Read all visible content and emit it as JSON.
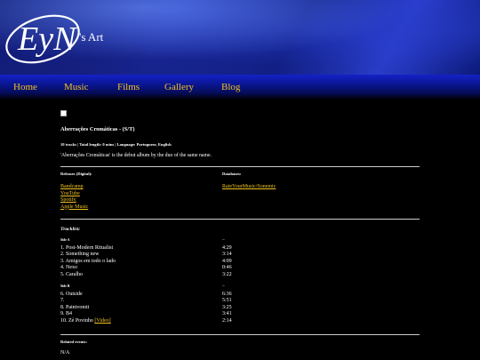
{
  "site": {
    "logo_text": "EyN",
    "brand_suffix": "'s Art"
  },
  "nav": [
    {
      "label": "Home"
    },
    {
      "label": "Music"
    },
    {
      "label": "Films"
    },
    {
      "label": "Gallery"
    },
    {
      "label": "Blog"
    }
  ],
  "album": {
    "title": "Aberrações Cromáticas - (S/T)",
    "meta": "10 tracks | Total length: 0 mins | Language: Portuguese, English",
    "description": "'Aberrações Cromáticas' is the debut album by the duo of the same name."
  },
  "releases": {
    "label": "Releases (Digital):",
    "links": [
      "Bandcamp",
      "YouTube",
      "Spotify",
      "Apple Music"
    ]
  },
  "databases": {
    "label": "Databases:",
    "links": [
      "RateYourMusic/Sonemic"
    ]
  },
  "tracklist": {
    "title": "Tracklist:",
    "sides": [
      {
        "label": "Side A",
        "dash": "--",
        "tracks": [
          {
            "title": "1. Post-Modern Ritualist",
            "duration": "4:29"
          },
          {
            "title": "2. Something new",
            "duration": "3:14"
          },
          {
            "title": "3. Amigos em todo o lado",
            "duration": "4:09"
          },
          {
            "title": "4. Nexo",
            "duration": "0:46"
          },
          {
            "title": "5. Caralho",
            "duration": "3:22"
          }
        ]
      },
      {
        "label": "Side B",
        "dash": "--",
        "tracks": [
          {
            "title": "6. Outside",
            "duration": "6:36"
          },
          {
            "title": "7.",
            "duration": "5:51"
          },
          {
            "title": "8. Paintvomit",
            "duration": "3:25"
          },
          {
            "title": "9. B4",
            "duration": "3:41"
          },
          {
            "title": "10. Zé Povinho",
            "video_label": "[Video]",
            "duration": "2:14"
          }
        ]
      }
    ]
  },
  "events": {
    "label": "Related events:",
    "value": "N/A"
  },
  "colors": {
    "link": "#f0c020",
    "background": "#000000",
    "banner_blue": "#1d2fb8"
  }
}
